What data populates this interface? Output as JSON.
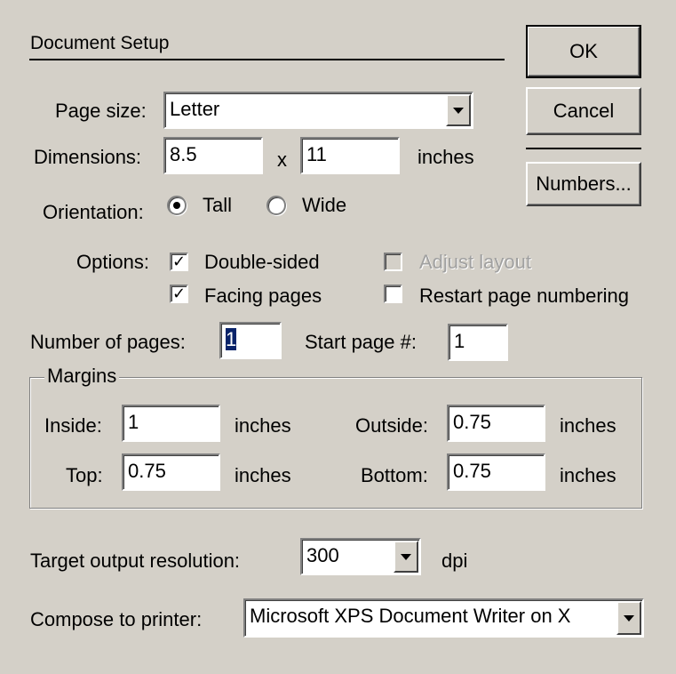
{
  "title": "Document Setup",
  "buttons": {
    "ok": "OK",
    "cancel": "Cancel",
    "numbers": "Numbers..."
  },
  "page_size": {
    "label": "Page size:",
    "value": "Letter"
  },
  "dimensions": {
    "label": "Dimensions:",
    "width": "8.5",
    "separator": "x",
    "height": "11",
    "unit": "inches"
  },
  "orientation": {
    "label": "Orientation:",
    "tall": "Tall",
    "wide": "Wide",
    "selected": "Tall"
  },
  "options": {
    "label": "Options:",
    "double_sided": {
      "label": "Double-sided",
      "checked": true
    },
    "facing_pages": {
      "label": "Facing pages",
      "checked": true
    },
    "adjust_layout": {
      "label": "Adjust layout",
      "checked": false,
      "enabled": false
    },
    "restart_numbering": {
      "label": "Restart page numbering",
      "checked": false
    }
  },
  "num_pages": {
    "label": "Number of pages:",
    "value": "1"
  },
  "start_page": {
    "label": "Start page #:",
    "value": "1"
  },
  "margins": {
    "legend": "Margins",
    "inside": {
      "label": "Inside:",
      "value": "1",
      "unit": "inches"
    },
    "outside": {
      "label": "Outside:",
      "value": "0.75",
      "unit": "inches"
    },
    "top": {
      "label": "Top:",
      "value": "0.75",
      "unit": "inches"
    },
    "bottom": {
      "label": "Bottom:",
      "value": "0.75",
      "unit": "inches"
    }
  },
  "resolution": {
    "label": "Target output resolution:",
    "value": "300",
    "unit": "dpi"
  },
  "printer": {
    "label": "Compose to printer:",
    "value": "Microsoft XPS Document Writer on X"
  },
  "colors": {
    "face": "#d4d0c8",
    "selection": "#0a246a"
  }
}
